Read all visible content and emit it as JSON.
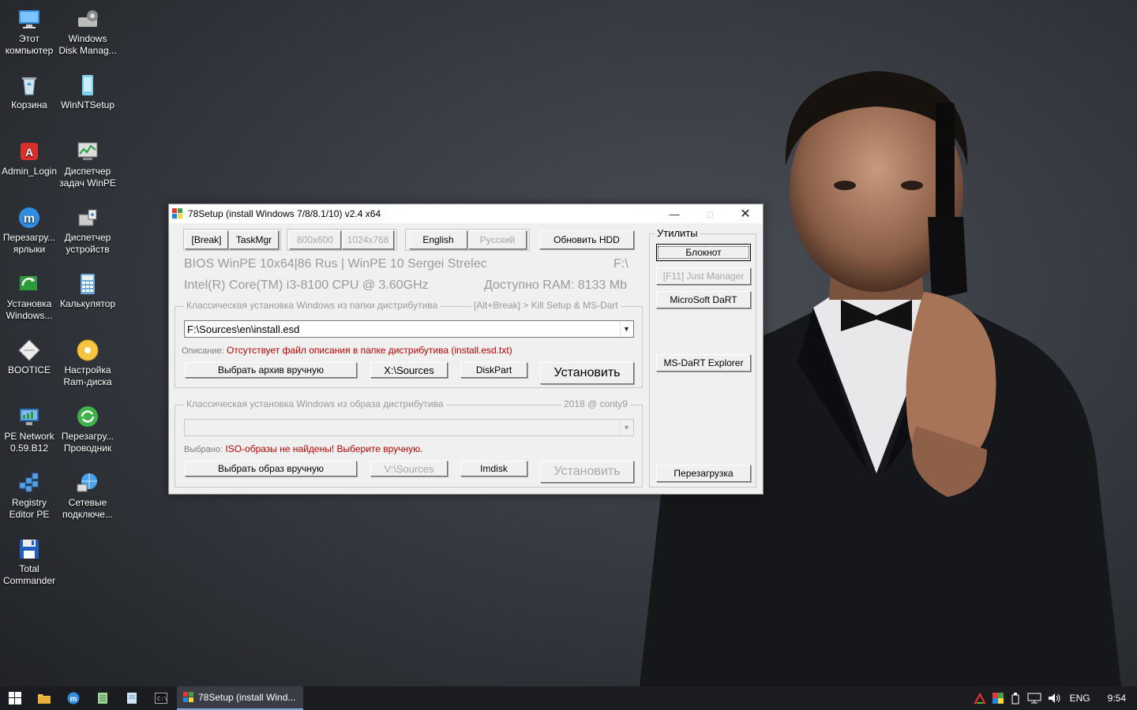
{
  "desktop": {
    "icons": [
      {
        "label": "Этот\nкомпьютер",
        "icon": "computer-icon"
      },
      {
        "label": "Windows\nDisk Manag...",
        "icon": "disk-manager-icon"
      },
      {
        "label": "Корзина",
        "icon": "recycle-bin-icon"
      },
      {
        "label": "WinNTSetup",
        "icon": "winntsetup-icon"
      },
      {
        "label": "Admin_Login",
        "icon": "admin-login-icon"
      },
      {
        "label": "Диспетчер\nзадач WinPE",
        "icon": "task-manager-icon"
      },
      {
        "label": "Перезагру...\nярлыки",
        "icon": "reload-shortcuts-icon"
      },
      {
        "label": "Диспетчер\nустройств",
        "icon": "device-manager-icon"
      },
      {
        "label": "Установка\nWindows...",
        "icon": "install-windows-icon"
      },
      {
        "label": "Калькулятор",
        "icon": "calculator-icon"
      },
      {
        "label": "BOOTICE",
        "icon": "bootice-icon"
      },
      {
        "label": "Настройка\nRam-диска",
        "icon": "ramdisk-icon"
      },
      {
        "label": "PE Network\n0.59.B12",
        "icon": "pe-network-icon"
      },
      {
        "label": "Перезагру...\nПроводник",
        "icon": "reload-explorer-icon"
      },
      {
        "label": "Registry\nEditor PE",
        "icon": "registry-editor-icon"
      },
      {
        "label": "Сетевые\nподключе...",
        "icon": "network-connections-icon"
      },
      {
        "label": "Total\nCommander",
        "icon": "total-commander-icon"
      }
    ]
  },
  "window": {
    "title": "78Setup (install Windows 7/8/8.1/10) v2.4 x64",
    "toolbar": {
      "break_label": "[Break]",
      "taskmgr_label": "TaskMgr",
      "res1_label": "800x600",
      "res2_label": "1024x768",
      "english_label": "English",
      "russian_label": "Русский",
      "update_hdd_label": "Обновить HDD"
    },
    "info": {
      "bios_line": "BIOS WinPE 10x64|86 Rus | WinPE 10 Sergei Strelec",
      "drive": "F:\\",
      "cpu_line": "Intel(R) Core(TM) i3-8100 CPU @ 3.60GHz",
      "ram_line": "Доступно RAM: 8133 Mb"
    },
    "group1": {
      "legend": "Классическая установка Windows из папки дистрибутива",
      "legend_right": "[Alt+Break] > Kill Setup & MS-Dart",
      "combo_value": "F:\\Sources\\en\\install.esd",
      "desc_key": "Описание:",
      "desc_value": "Отсутствует файл описания в папке дистрибутива (install.esd.txt)",
      "choose_label": "Выбрать архив вручную",
      "sources_label": "X:\\Sources",
      "diskpart_label": "DiskPart",
      "install_label": "Установить"
    },
    "group2": {
      "legend": "Классическая установка Windows из образа дистрибутива",
      "legend_right": "2018 @ conty9",
      "combo_value": "",
      "desc_key": "Выбрано:",
      "desc_value": "ISO-образы не найдены! Выберите вручную.",
      "choose_label": "Выбрать образ вручную",
      "sources_label": "V:\\Sources",
      "imdisk_label": "Imdisk",
      "install_label": "Установить"
    },
    "utilities": {
      "legend": "Утилиты",
      "notepad_label": "Блокнот",
      "justmanager_label": "[F11]  Just Manager",
      "msdart_label": "MicroSoft DaRT",
      "msdart_explorer_label": "MS-DaRT Explorer",
      "reboot_label": "Перезагрузка"
    }
  },
  "taskbar": {
    "active_task_label": "78Setup (install Wind...",
    "lang": "ENG",
    "time": "9:54"
  }
}
